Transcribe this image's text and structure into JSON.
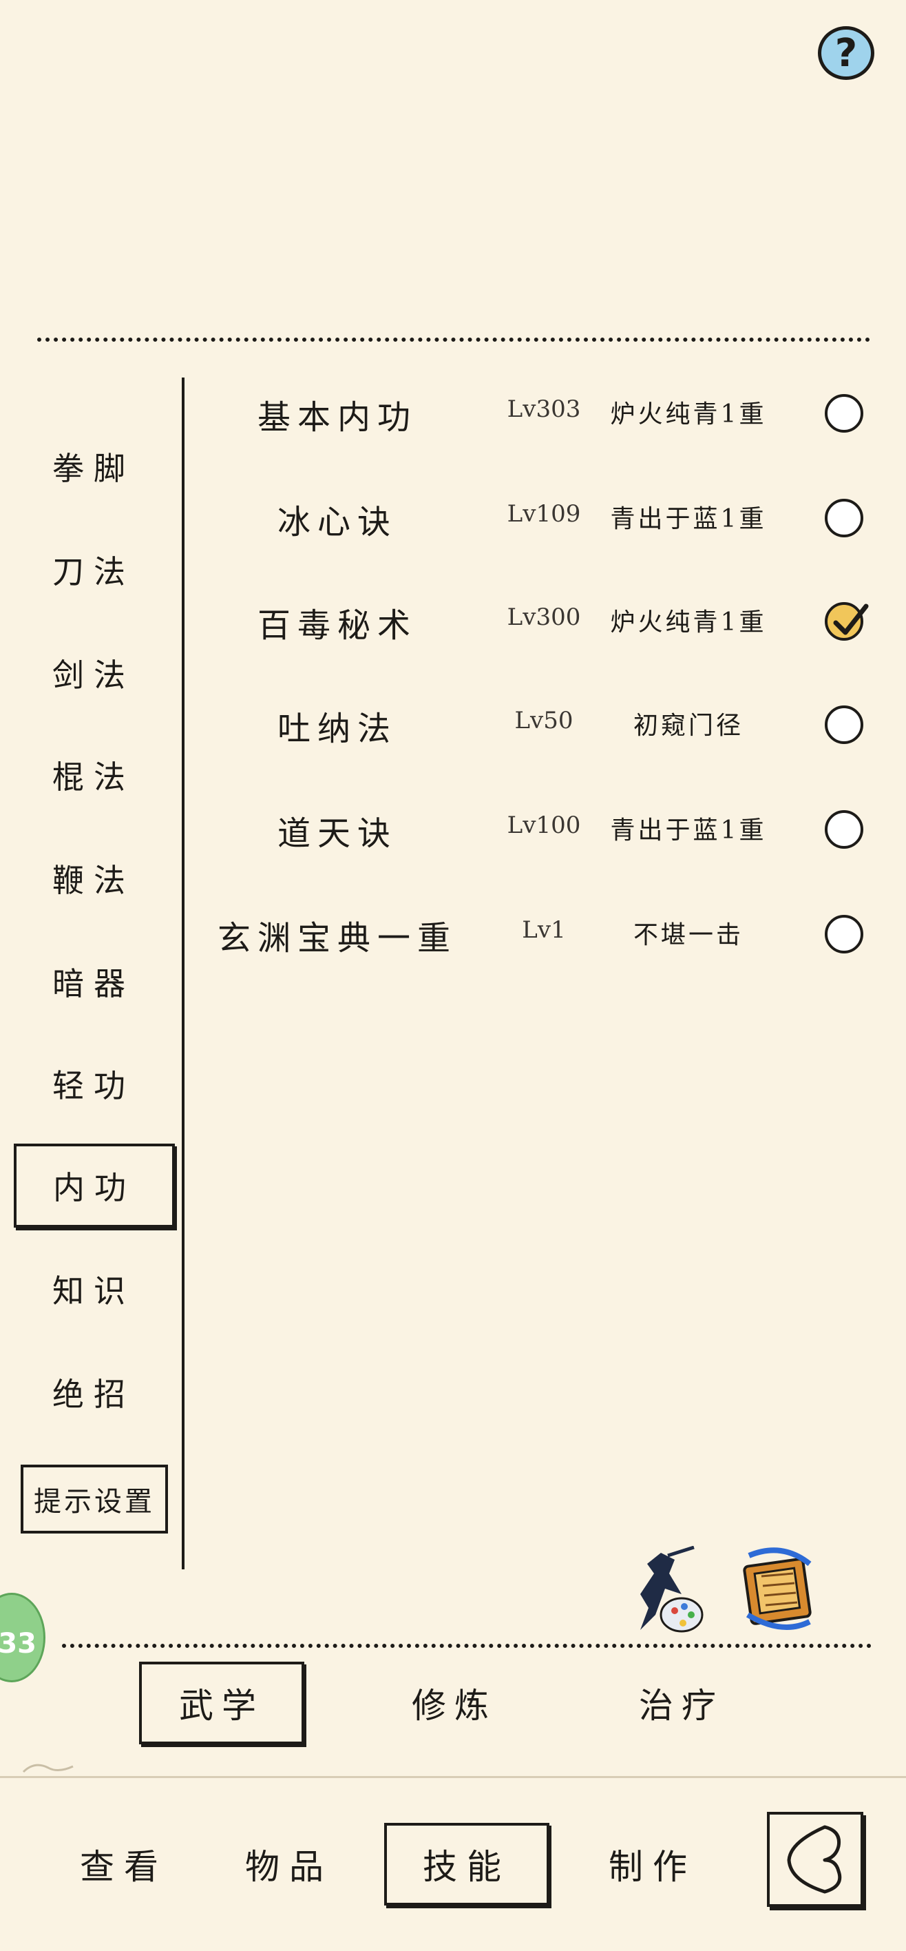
{
  "header": {
    "help_label": "?"
  },
  "categories": [
    {
      "label": "拳脚"
    },
    {
      "label": "刀法"
    },
    {
      "label": "剑法"
    },
    {
      "label": "棍法"
    },
    {
      "label": "鞭法"
    },
    {
      "label": "暗器"
    },
    {
      "label": "轻功"
    },
    {
      "label": "内功",
      "active": true
    },
    {
      "label": "知识"
    },
    {
      "label": "绝招"
    }
  ],
  "hint_settings_label": "提示设置",
  "skills": [
    {
      "name": "基本内功",
      "level": "Lv303",
      "rank": "炉火纯青1重",
      "checked": false
    },
    {
      "name": "冰心诀",
      "level": "Lv109",
      "rank": "青出于蓝1重",
      "checked": false
    },
    {
      "name": "百毒秘术",
      "level": "Lv300",
      "rank": "炉火纯青1重",
      "checked": true
    },
    {
      "name": "吐纳法",
      "level": "Lv50",
      "rank": "初窥门径",
      "checked": false
    },
    {
      "name": "道天诀",
      "level": "Lv100",
      "rank": "青出于蓝1重",
      "checked": false
    },
    {
      "name": "玄渊宝典一重",
      "level": "Lv1",
      "rank": "不堪一击",
      "checked": false
    }
  ],
  "badge_count": "33",
  "sub_tabs": [
    {
      "label": "武学",
      "active": true
    },
    {
      "label": "修炼"
    },
    {
      "label": "治疗"
    }
  ],
  "bottom_nav": [
    {
      "label": "查看"
    },
    {
      "label": "物品"
    },
    {
      "label": "技能",
      "active": true
    },
    {
      "label": "制作"
    }
  ]
}
